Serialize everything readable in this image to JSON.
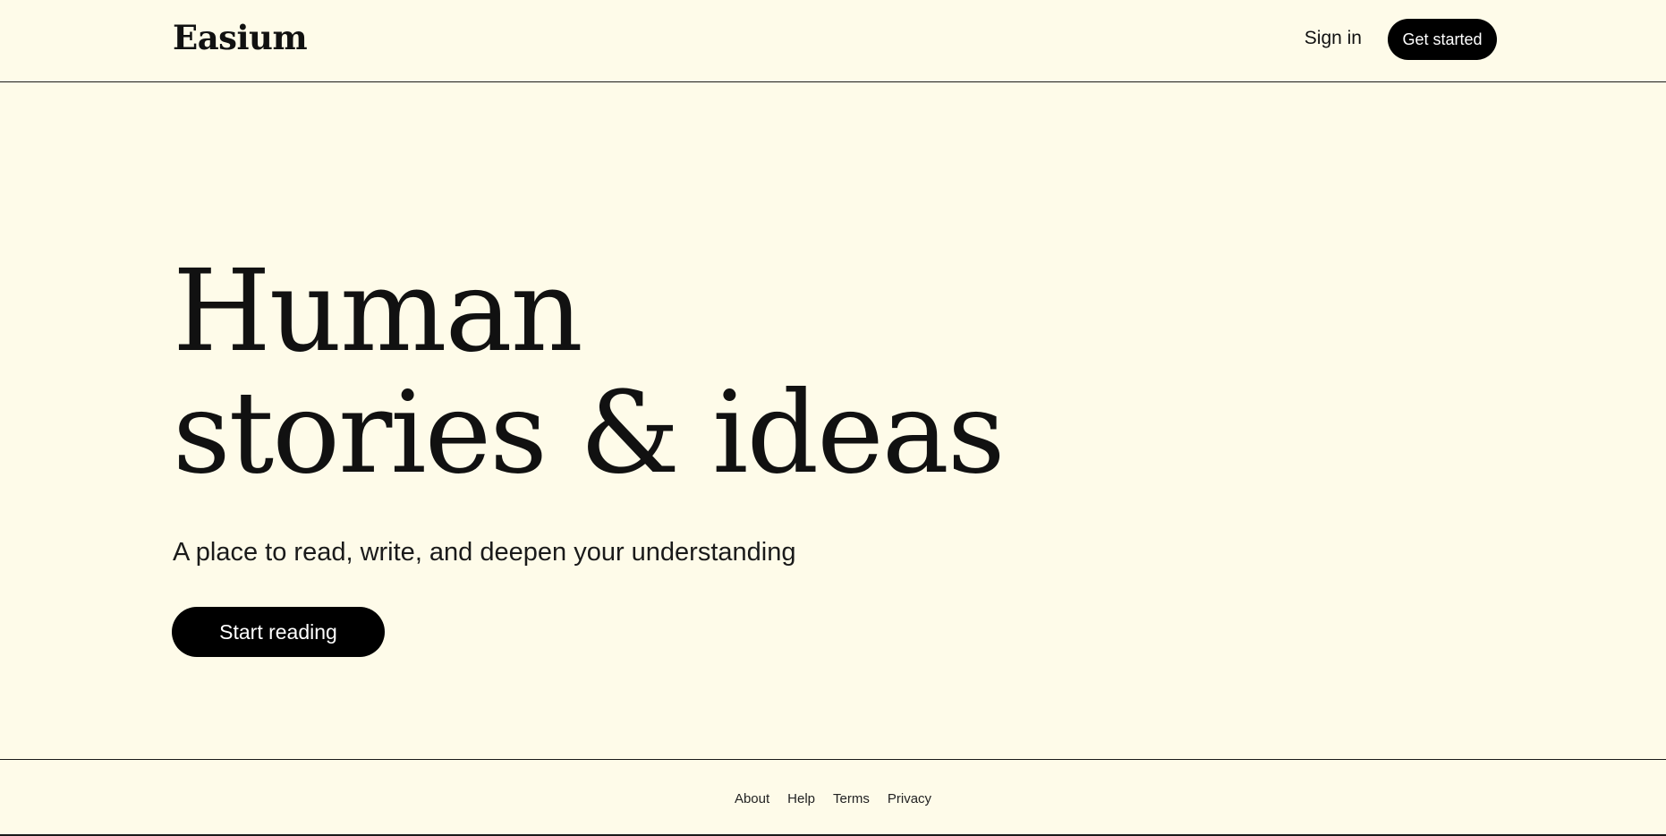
{
  "header": {
    "logo": "Easium",
    "sign_in_label": "Sign in",
    "get_started_label": "Get started"
  },
  "hero": {
    "title_line1": "Human",
    "title_line2": "stories & ideas",
    "subtitle": "A place to read, write, and deepen your understanding",
    "cta_label": "Start reading"
  },
  "footer": {
    "links": [
      "About",
      "Help",
      "Terms",
      "Privacy"
    ]
  },
  "colors": {
    "background": "#fefbe9",
    "button_bg": "#000000",
    "button_text": "#ffffff",
    "text": "#111111"
  }
}
